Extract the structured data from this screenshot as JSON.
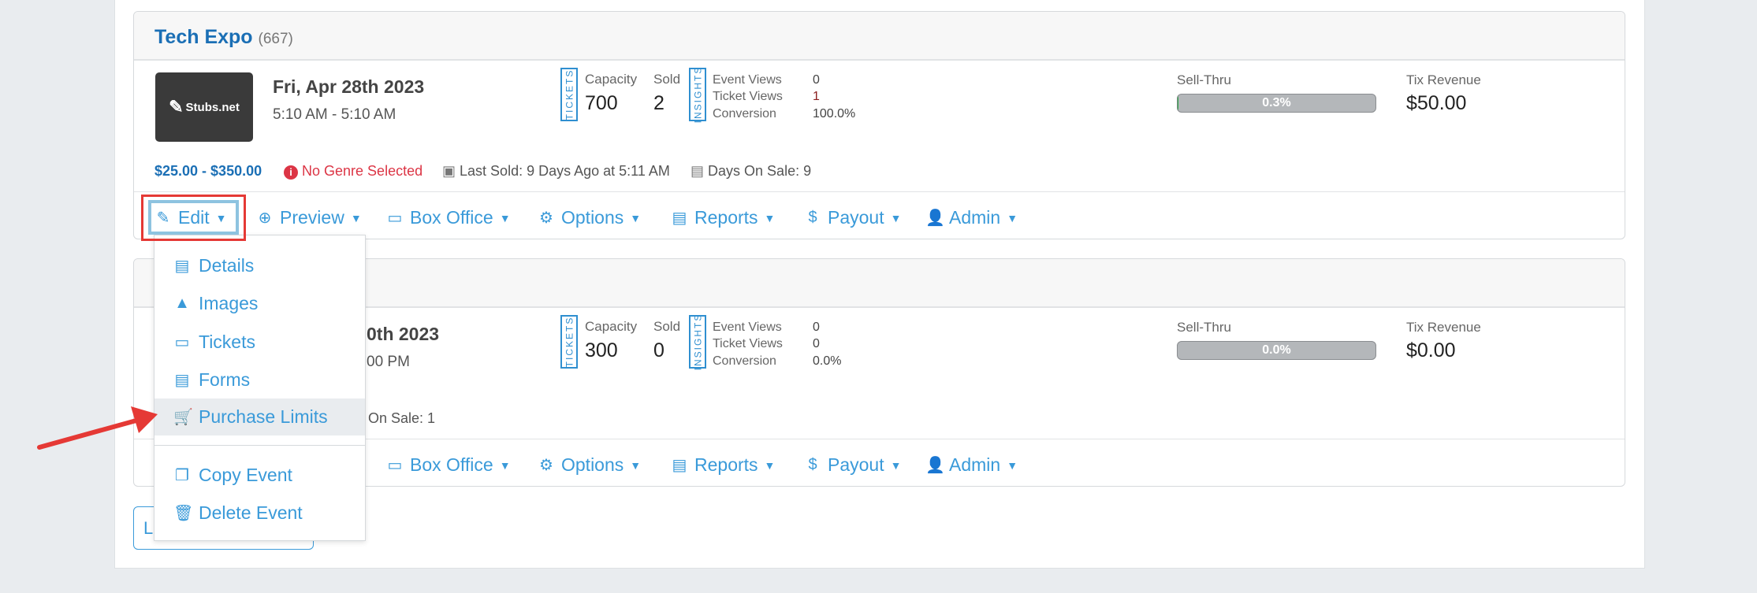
{
  "events": [
    {
      "title": "Tech Expo",
      "count": "(667)",
      "logo_text": "Stubs.net",
      "date": "Fri, Apr 28th 2023",
      "time": "5:10 AM - 5:10 AM",
      "tickets_label": "TICKETS",
      "capacity_label": "Capacity",
      "capacity": "700",
      "sold_label": "Sold",
      "sold": "2",
      "insights_label": "INSIGHTS",
      "event_views_label": "Event Views",
      "event_views": "0",
      "ticket_views_label": "Ticket Views",
      "ticket_views": "1",
      "conversion_label": "Conversion",
      "conversion": "100.0%",
      "sell_thru_label": "Sell-Thru",
      "sell_thru": "0.3%",
      "sell_thru_value": 0.3,
      "revenue_label": "Tix Revenue",
      "revenue": "$50.00",
      "price_range": "$25.00 - $350.00",
      "genre_warning": "No Genre Selected",
      "last_sold": "Last Sold: 9 Days Ago at 5:11 AM",
      "days_on_sale": "Days On Sale: 9"
    },
    {
      "date_partial": "0th 2023",
      "time_partial": "00 PM",
      "tickets_label": "TICKETS",
      "capacity_label": "Capacity",
      "capacity": "300",
      "sold_label": "Sold",
      "sold": "0",
      "insights_label": "INSIGHTS",
      "event_views_label": "Event Views",
      "event_views": "0",
      "ticket_views_label": "Ticket Views",
      "ticket_views": "0",
      "conversion_label": "Conversion",
      "conversion": "0.0%",
      "sell_thru_label": "Sell-Thru",
      "sell_thru": "0.0%",
      "sell_thru_value": 0,
      "revenue_label": "Tix Revenue",
      "revenue": "$0.00",
      "days_on_sale_partial": "On Sale: 1"
    }
  ],
  "actions": {
    "edit": "Edit",
    "preview": "Preview",
    "box_office": "Box Office",
    "options": "Options",
    "reports": "Reports",
    "payout": "Payout",
    "admin": "Admin"
  },
  "edit_menu": {
    "items": [
      "Details",
      "Images",
      "Tickets",
      "Forms",
      "Purchase Limits"
    ],
    "copy": "Copy Event",
    "delete": "Delete Event",
    "highlighted": "Purchase Limits"
  },
  "bottom_button_partial": "L",
  "colors": {
    "link": "#3a9ad9",
    "title": "#1b6fb5",
    "warning": "#dc3545",
    "annotation": "#e53935"
  }
}
